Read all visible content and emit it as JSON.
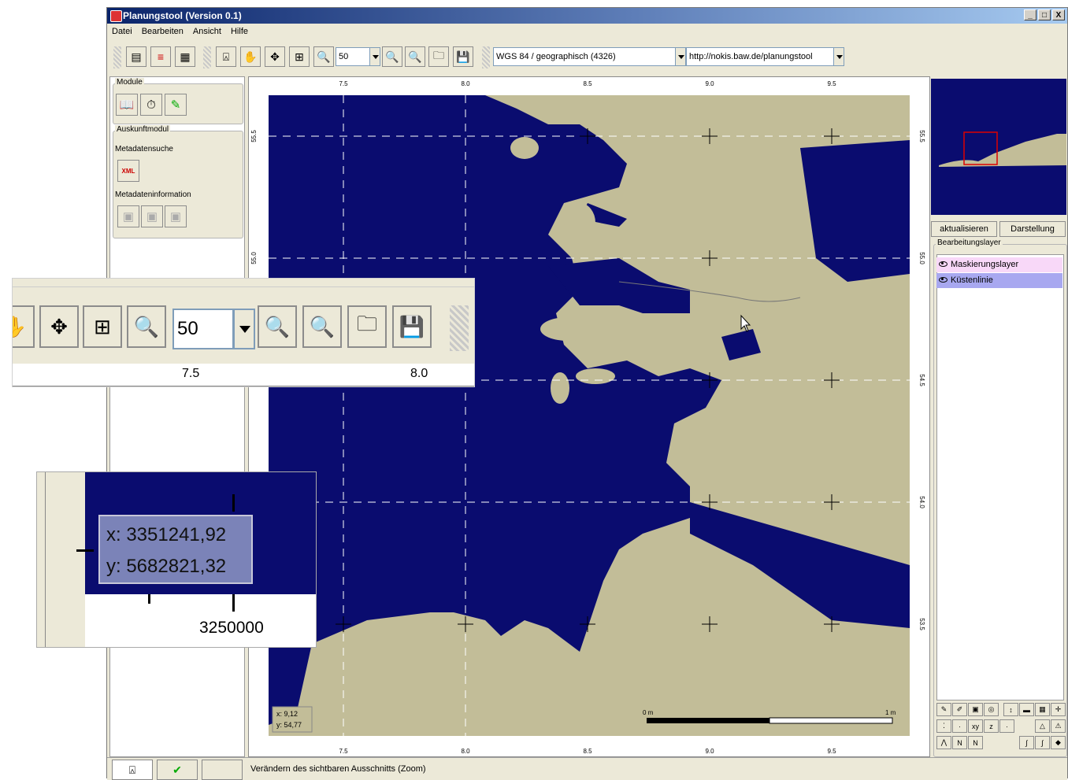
{
  "window": {
    "title": "Planungstool (Version 0.1)",
    "controls": [
      "_",
      "□",
      "X"
    ]
  },
  "menu": [
    "Datei",
    "Bearbeiten",
    "Ansicht",
    "Hilfe"
  ],
  "toolbar": {
    "zoom_value": "50",
    "crs": "WGS 84 / geographisch (4326)",
    "server": "http://nokis.baw.de/planungstool"
  },
  "left": {
    "modules_title": "Module",
    "info_module_title": "Auskunftmodul",
    "metadata_search": "Metadatensuche",
    "metadata_info": "Metadateninformation"
  },
  "map": {
    "x_ticks": [
      "7.5",
      "8.0",
      "8.5",
      "9.0",
      "9.5"
    ],
    "y_ticks": [
      "55.5",
      "55.0",
      "54.5",
      "54.0",
      "53.5"
    ],
    "coord_x": "x: 9,12",
    "coord_y": "y: 54,77",
    "scale_start": "0 m",
    "scale_end": "1 m",
    "colors": {
      "water": "#0a0c6f",
      "land": "#c2bd98"
    }
  },
  "right": {
    "refresh": "aktualisieren",
    "display": "Darstellung",
    "layer_title": "Bearbeitungslayer",
    "layers": [
      {
        "name": "Maskierungslayer",
        "color": "#f8d8f8"
      },
      {
        "name": "Küstenlinie",
        "color": "#a8a8f0"
      }
    ],
    "edit_tools": [
      [
        "pencil-icon",
        "eraser-icon",
        "stamp-icon",
        "circle-icon",
        "cursor-icon",
        "fill-icon",
        "grid-icon",
        "move-icon"
      ],
      [
        "points-icon",
        "point-icon",
        "xy-icon",
        "z-icon",
        "dot-icon",
        "triangle-icon",
        "triangle-excl-icon"
      ],
      [
        "line-icon",
        "polyline-icon",
        "polyline2-icon",
        "curve-icon",
        "curve2-icon",
        "diamond-icon"
      ]
    ]
  },
  "status": {
    "text": "Verändern des sichtbaren Ausschnitts (Zoom)"
  },
  "zoom_overlay": {
    "zoom_value": "50",
    "ticks": [
      "7.5",
      "8.0"
    ]
  },
  "coord_overlay": {
    "x": "x: 3351241,92",
    "y": "y: 5682821,32",
    "tick": "3250000"
  }
}
